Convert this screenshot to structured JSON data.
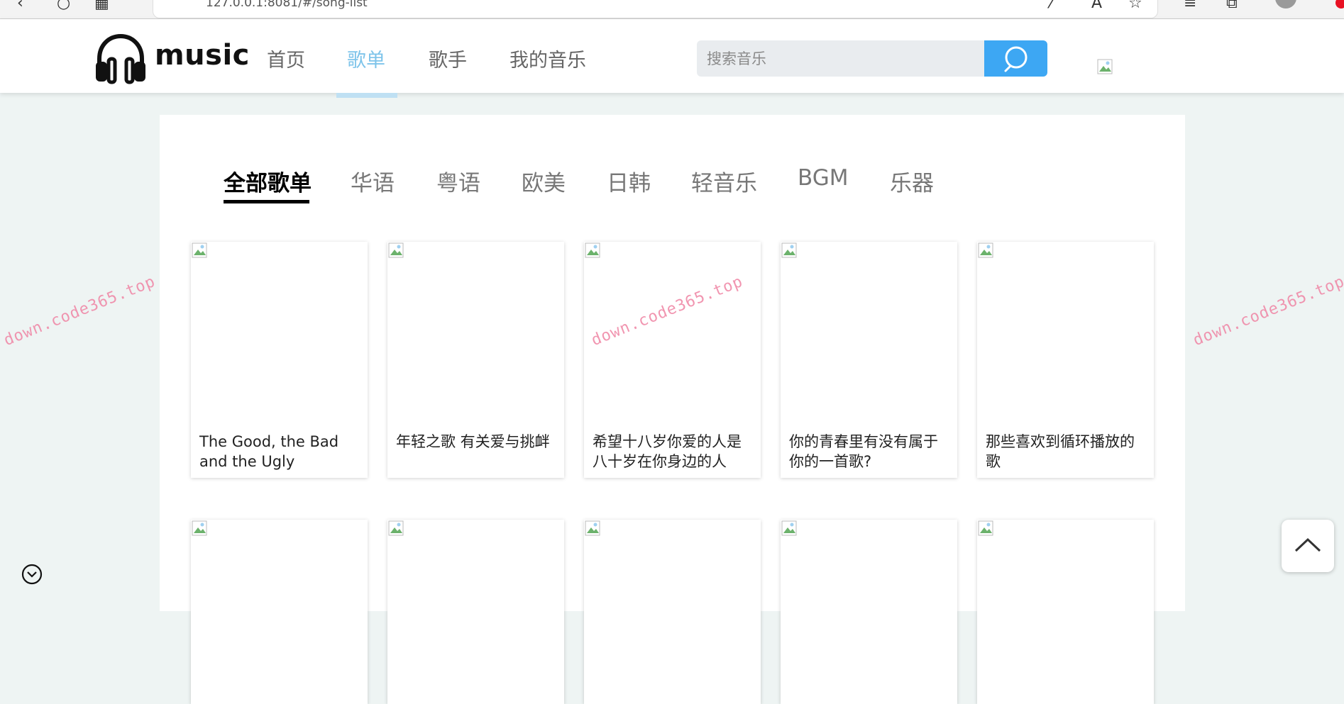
{
  "browser": {
    "address": "127.0.0.1:8081/#/song-list"
  },
  "header": {
    "logo_text": "music",
    "nav": [
      {
        "label": "首页"
      },
      {
        "label": "歌单"
      },
      {
        "label": "歌手"
      },
      {
        "label": "我的音乐"
      }
    ],
    "active_nav": "歌单",
    "search_placeholder": "搜索音乐"
  },
  "tabs": [
    {
      "label": "全部歌单"
    },
    {
      "label": "华语"
    },
    {
      "label": "粤语"
    },
    {
      "label": "欧美"
    },
    {
      "label": "日韩"
    },
    {
      "label": "轻音乐"
    },
    {
      "label": "BGM"
    },
    {
      "label": "乐器"
    }
  ],
  "active_tab": "全部歌单",
  "playlists": [
    {
      "title": "The Good, the Bad and the Ugly"
    },
    {
      "title": "年轻之歌 有关爱与挑衅"
    },
    {
      "title": "希望十八岁你爱的人是八十岁在你身边的人"
    },
    {
      "title": "你的青春里有没有属于你的一首歌?"
    },
    {
      "title": "那些喜欢到循环播放的歌"
    }
  ],
  "watermark": "down.code365.top",
  "colors": {
    "accent": "#3da7f3",
    "active_nav": "#7ec4ea",
    "page_bg": "#eef4f3"
  },
  "icons": {
    "logo": "headphones-icon",
    "search": "search-icon",
    "back_to_top": "chevron-up-icon",
    "down": "chevron-down-circle-icon"
  }
}
